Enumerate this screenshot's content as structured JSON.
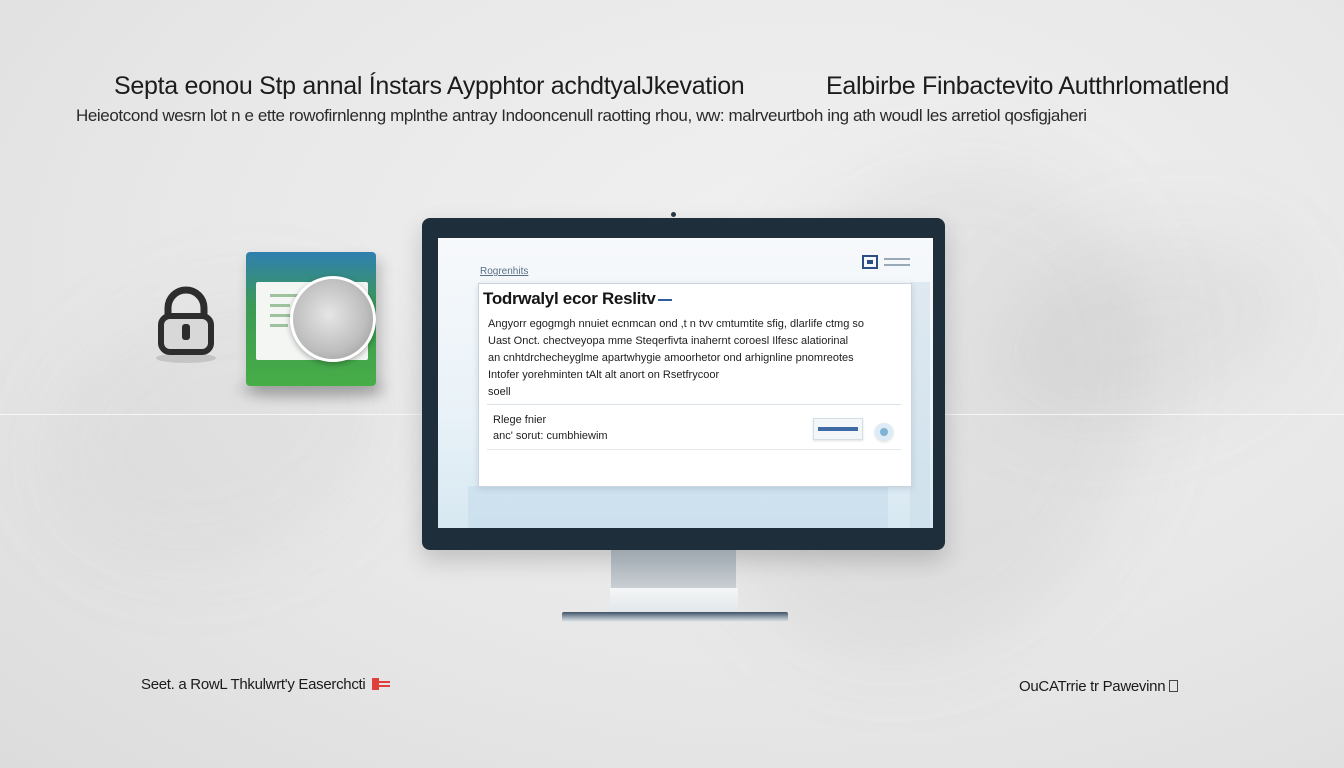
{
  "header": {
    "headline_left": "Septa еonou Stp annal Ínstars Aypphtor achdtyalJkevation",
    "headline_right": "Ealbirbe Finbactevito Autthrlomatlend",
    "subline": "Heieotcond wesrn lot n e ette rowofirnlenng mplnthe antray Indooncenull raotting rhou, ww: malrveurtboh ing ath woudl les arretiol qosfigjaheri"
  },
  "screen": {
    "label": "Rogrenhits",
    "card": {
      "title": "Todrwalyl ecor Reslitv",
      "body": [
        "Angyorr egogmgh nnuiet ecnmcan ond ,t n tvv cmtumtite sfig, dlarlife ctmg so",
        "Uast Onct. chectveyopa mme Steqerfivta inahernt coroesl Ilfesc alatiorinal",
        "an cnhtdrchecheyglme apartwhygie amoorhetor ond arhignline pnomreotes",
        "Intofer yorehminten tAlt alt anort on Rsetfrycoor",
        "soell"
      ],
      "sub_label": "Rlege fnier",
      "sub_text": "anc' sorut: cumbhiewim"
    }
  },
  "footer": {
    "left": "Seet. a RowL Thkulwrt'y Easerchcti",
    "right": "OuCATrrie tr Pawevinn"
  },
  "colors": {
    "monitor_bezel": "#1e2e3b",
    "accent_blue": "#2f5e9c",
    "tablet_green": "#47ad46",
    "footer_mark_red": "#e0403c"
  },
  "icons": {
    "lock": "padlock-icon",
    "tablet": "tablet-device",
    "logo": "app-logo-icon",
    "action": "circle-action-icon",
    "footer_left": "red-flag-icon",
    "footer_right": "document-icon"
  }
}
